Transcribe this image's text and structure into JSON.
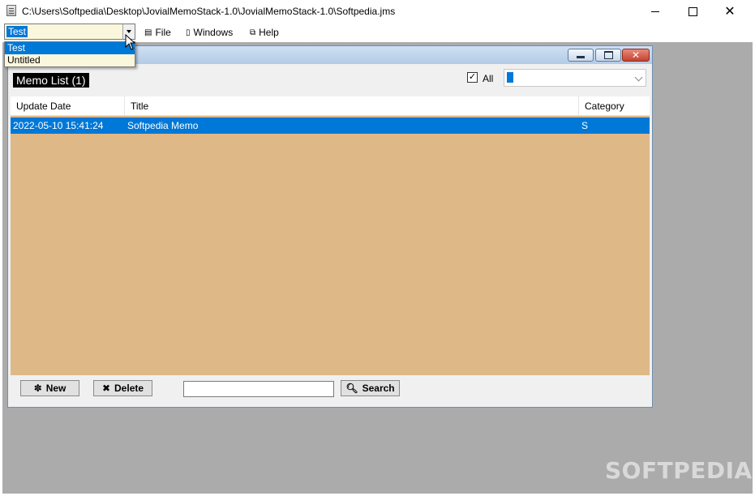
{
  "window": {
    "title": "C:\\Users\\Softpedia\\Desktop\\JovialMemoStack-1.0\\JovialMemoStack-1.0\\Softpedia.jms",
    "icon": "app-document-icon"
  },
  "toolbar": {
    "stack_combo_value": "Test",
    "stack_options": [
      "Test",
      "Untitled"
    ],
    "menu": [
      {
        "label": "File",
        "icon": "file-icon"
      },
      {
        "label": "Windows",
        "icon": "window-icon"
      },
      {
        "label": "Help",
        "icon": "help-icon"
      }
    ]
  },
  "memo_window": {
    "list_title": "Memo List (1)",
    "all_checkbox": {
      "label": "All",
      "checked": true
    },
    "category_filter_value": "",
    "columns": [
      "Update Date",
      "Title",
      "Category"
    ],
    "rows": [
      {
        "update_date": "2022-05-10 15:41:24",
        "title": "Softpedia Memo",
        "category": "S",
        "selected": true
      }
    ],
    "buttons": {
      "new": "New",
      "delete": "Delete",
      "search": "Search"
    },
    "search_value": ""
  },
  "watermark": "SOFTPEDIA®",
  "colors": {
    "selection": "#0078d7",
    "list_background": "#deb887",
    "mdi_background": "#ababab",
    "combo_background": "#fbf7dc"
  }
}
